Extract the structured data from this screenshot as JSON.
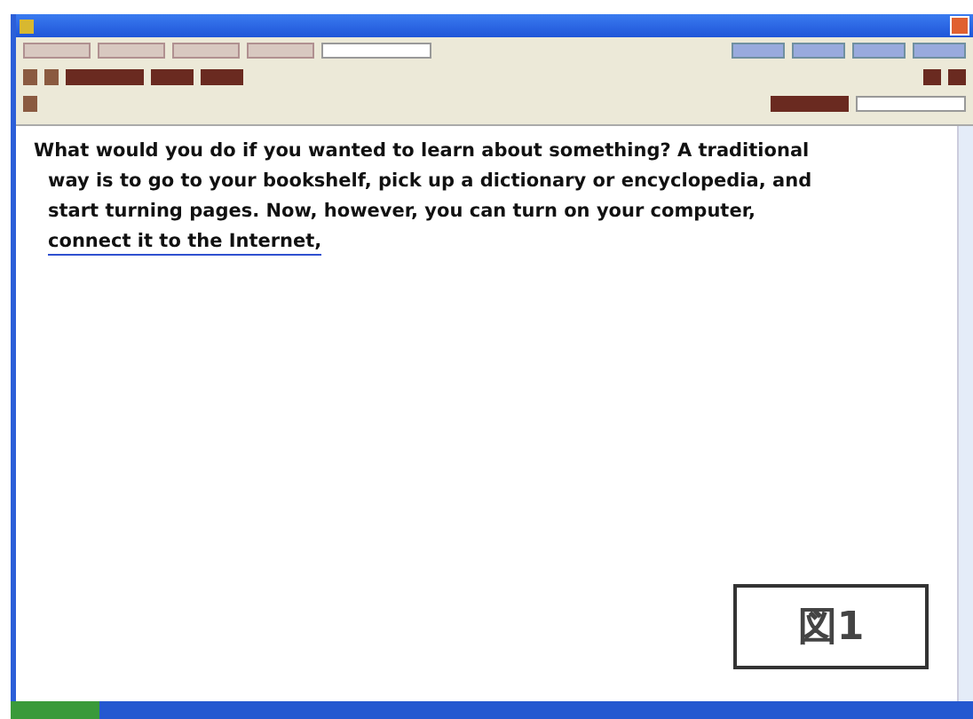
{
  "document": {
    "lines": [
      "What would you do if you wanted to learn about something? A traditional",
      "way is to go to your bookshelf, pick up a dictionary or encyclopedia, and",
      "start turning pages. Now, however, you can turn on your computer,"
    ],
    "link": "connect it to the Internet,"
  },
  "figure_label": "図1"
}
